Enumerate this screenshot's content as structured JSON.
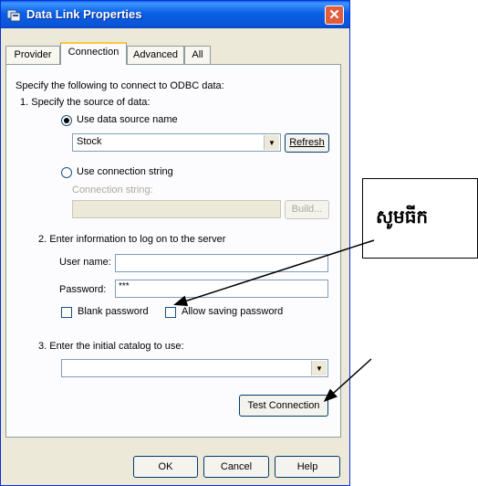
{
  "window": {
    "title": "Data Link Properties",
    "close_glyph": "✕"
  },
  "tabs": [
    {
      "label": "Provider"
    },
    {
      "label": "Connection",
      "active": true
    },
    {
      "label": "Advanced"
    },
    {
      "label": "All"
    }
  ],
  "connection": {
    "intro": "Specify the following to connect to ODBC data:",
    "step1": "1. Specify the source of data:",
    "use_dsn_label": "Use data source name",
    "use_dsn_selected": true,
    "dsn_value": "Stock",
    "refresh_label": "Refresh",
    "use_connstr_label": "Use connection string",
    "connstr_label": "Connection string:",
    "build_label": "Build...",
    "step2": "2. Enter information to log on to the server",
    "username_label": "User name:",
    "username_value": "",
    "password_label": "Password:",
    "password_value": "***",
    "blank_password_label": "Blank password",
    "allow_saving_label": "Allow saving password",
    "step3": "3. Enter the initial catalog to use:",
    "catalog_value": "",
    "test_connection_label": "Test Connection"
  },
  "footer": {
    "ok_label": "OK",
    "cancel_label": "Cancel",
    "help_label": "Help"
  },
  "annotation": {
    "text": "សូមធីក"
  }
}
